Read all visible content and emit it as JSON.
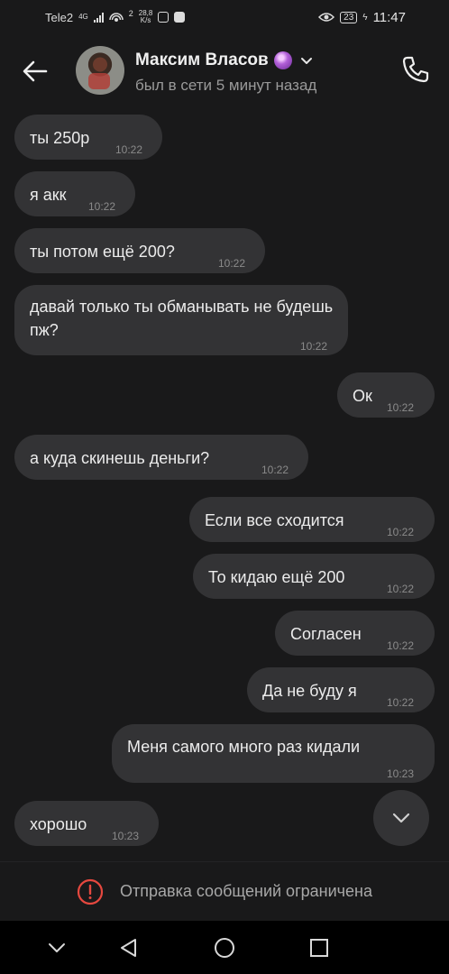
{
  "status_bar": {
    "carrier": "Tele2",
    "network": "4G",
    "hotspot_count": "2",
    "speed_value": "28,8",
    "speed_unit": "K/s",
    "battery": "23",
    "time": "11:47"
  },
  "header": {
    "contact_name": "Максим Власов",
    "status": "был в сети 5 минут назад"
  },
  "messages": [
    {
      "side": "in",
      "text": "ты 250р",
      "time": "10:22"
    },
    {
      "side": "in",
      "text": "я акк",
      "time": "10:22"
    },
    {
      "side": "in",
      "text": "ты потом ещё 200?",
      "time": "10:22"
    },
    {
      "side": "in",
      "text": "давай только ты обманывать не будешь пж?",
      "time": "10:22"
    },
    {
      "side": "out",
      "text": "Ок",
      "time": "10:22"
    },
    {
      "side": "in",
      "text": "а куда скинешь деньги?",
      "time": "10:22"
    },
    {
      "side": "out",
      "text": "Если все сходится",
      "time": "10:22"
    },
    {
      "side": "out",
      "text": "То кидаю ещё 200",
      "time": "10:22"
    },
    {
      "side": "out",
      "text": "Согласен",
      "time": "10:22"
    },
    {
      "side": "out",
      "text": "Да не буду я",
      "time": "10:22"
    },
    {
      "side": "out",
      "text": "Меня самого много раз кидали",
      "time": "10:23"
    },
    {
      "side": "in",
      "text": "хорошо",
      "time": "10:23"
    }
  ],
  "restriction": {
    "text": "Отправка сообщений ограничена"
  },
  "colors": {
    "background": "#19191a",
    "bubble": "#333335",
    "alert": "#e5483f",
    "secondary_text": "#9a9a9a"
  },
  "icons": {
    "back": "arrow-left-icon",
    "call": "phone-icon",
    "verified": "crystal-ball-icon",
    "dropdown": "chevron-down-icon",
    "scroll": "chevron-down-icon",
    "alert": "alert-circle-icon",
    "nav_back": "triangle-back-icon",
    "nav_home": "circle-home-icon",
    "nav_recent": "square-recent-icon",
    "nav_hide": "chevron-down-icon"
  }
}
